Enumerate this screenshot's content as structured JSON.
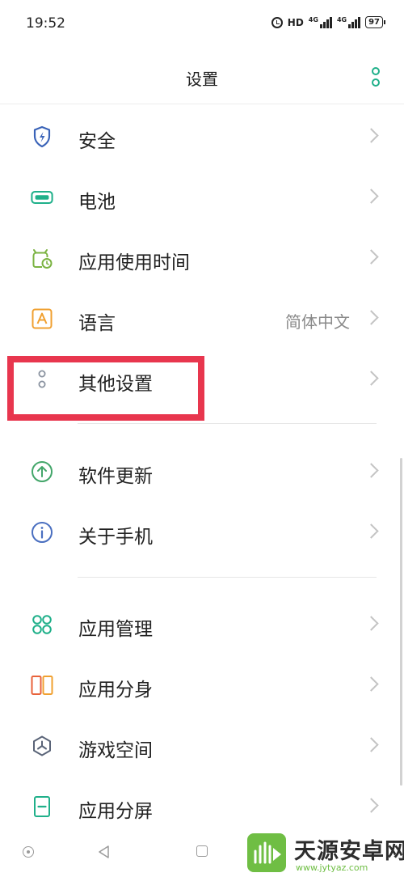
{
  "status": {
    "time": "19:52",
    "hd": "HD",
    "net1": "4G",
    "net2": "4G",
    "battery": "97"
  },
  "header": {
    "title": "设置"
  },
  "colors": {
    "accent": "#20b08a",
    "highlight": "#e8364e"
  },
  "groups": [
    {
      "items": [
        {
          "id": "security",
          "label": "安全",
          "icon": "shield-icon"
        },
        {
          "id": "battery",
          "label": "电池",
          "icon": "battery-icon"
        },
        {
          "id": "app-usage",
          "label": "应用使用时间",
          "icon": "screen-time-icon"
        },
        {
          "id": "language",
          "label": "语言",
          "value": "简体中文",
          "icon": "language-icon"
        },
        {
          "id": "other-settings",
          "label": "其他设置",
          "icon": "other-settings-icon"
        }
      ]
    },
    {
      "items": [
        {
          "id": "software-update",
          "label": "软件更新",
          "icon": "update-arrow-icon"
        },
        {
          "id": "about-phone",
          "label": "关于手机",
          "icon": "info-icon"
        }
      ]
    },
    {
      "items": [
        {
          "id": "app-management",
          "label": "应用管理",
          "icon": "app-grid-icon"
        },
        {
          "id": "app-clone",
          "label": "应用分身",
          "icon": "app-clone-icon"
        },
        {
          "id": "game-space",
          "label": "游戏空间",
          "icon": "game-space-icon"
        },
        {
          "id": "split-screen",
          "label": "应用分屏",
          "icon": "split-screen-icon"
        }
      ]
    }
  ],
  "watermark": {
    "brand": "天源安卓网",
    "url": "www.jytyaz.com"
  }
}
